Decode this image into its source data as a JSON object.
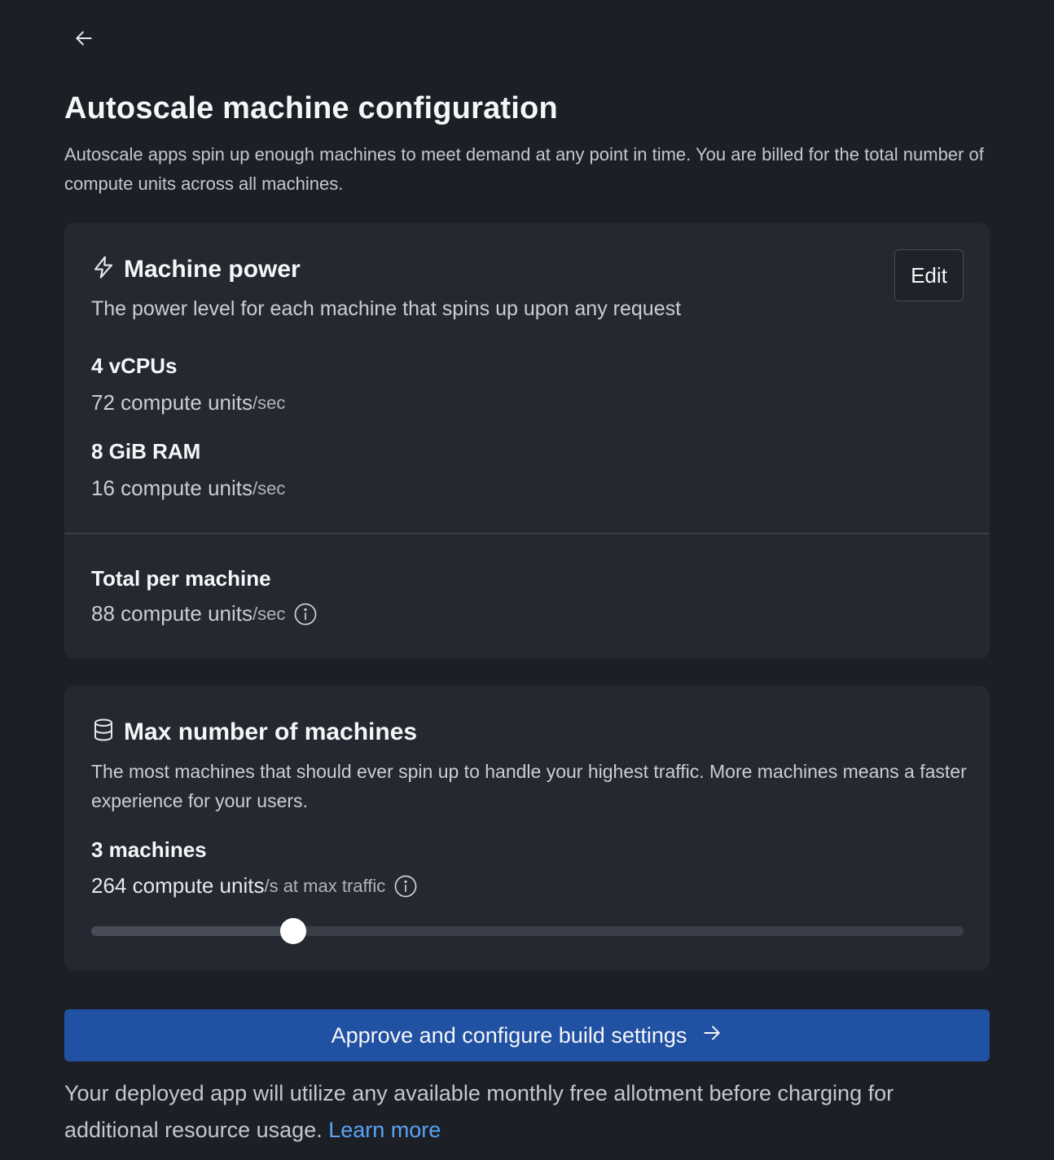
{
  "page": {
    "title": "Autoscale machine configuration",
    "subtitle": "Autoscale apps spin up enough machines to meet demand at any point in time. You are billed for the total number of compute units across all machines."
  },
  "machine_power": {
    "icon": "lightning-icon",
    "title": "Machine power",
    "description": "The power level for each machine that spins up upon any request",
    "edit_label": "Edit",
    "cpu": {
      "label": "4 vCPUs",
      "value": "72 compute units",
      "unit": "/sec"
    },
    "ram": {
      "label": "8 GiB RAM",
      "value": "16 compute units",
      "unit": "/sec"
    },
    "total": {
      "label": "Total per machine",
      "value": "88 compute units",
      "unit": "/sec"
    }
  },
  "max_machines": {
    "icon": "database-icon",
    "title": "Max number of machines",
    "description": "The most machines that should ever spin up to handle your highest traffic. More machines means a faster experience for your users.",
    "count_label": "3 machines",
    "compute_value": "264 compute units",
    "compute_unit": "/s at max traffic",
    "slider_fraction": 0.232
  },
  "actions": {
    "approve_label": "Approve and configure build settings"
  },
  "footer": {
    "note": "Your deployed app will utilize any available monthly free allotment before charging for additional resource usage.",
    "link_label": "Learn more"
  },
  "colors": {
    "background": "#1c1f26",
    "card": "#252831",
    "primary": "#2151a2",
    "link": "#5aa3f5"
  }
}
